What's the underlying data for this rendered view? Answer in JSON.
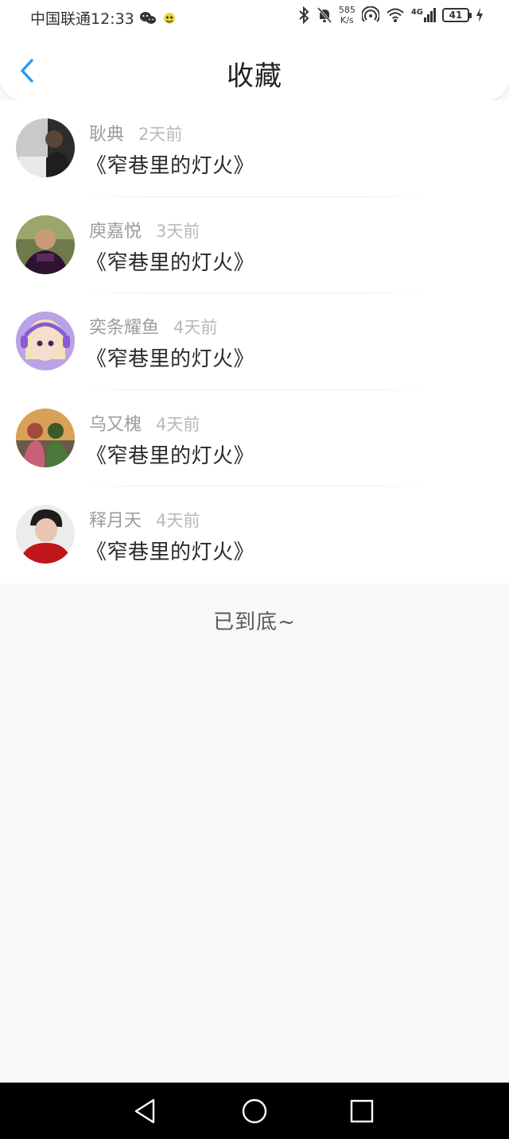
{
  "status_bar": {
    "carrier_time": "中国联通12:33",
    "net_speed_value": "585",
    "net_speed_unit": "K/s",
    "signal_type": "4G",
    "battery": "41"
  },
  "header": {
    "title": "收藏"
  },
  "favorites": [
    {
      "user": "耿典",
      "time": "2天前",
      "book": "《窄巷里的灯火》"
    },
    {
      "user": "庾嘉悦",
      "time": "3天前",
      "book": "《窄巷里的灯火》"
    },
    {
      "user": "奕条耀鱼",
      "time": "4天前",
      "book": "《窄巷里的灯火》"
    },
    {
      "user": "乌又槐",
      "time": "4天前",
      "book": "《窄巷里的灯火》"
    },
    {
      "user": "释月天",
      "time": "4天前",
      "book": "《窄巷里的灯火》"
    }
  ],
  "footer": {
    "end_text": "已到底~"
  },
  "icons": {
    "back": "chevron-left-icon",
    "nav_back": "triangle-back-icon",
    "nav_home": "circle-home-icon",
    "nav_recent": "square-recent-icon"
  },
  "colors": {
    "accent": "#2a9df4",
    "text_primary": "#2a2a2a",
    "text_secondary": "#9c9c9c",
    "page_bg": "#f9f7f8"
  }
}
